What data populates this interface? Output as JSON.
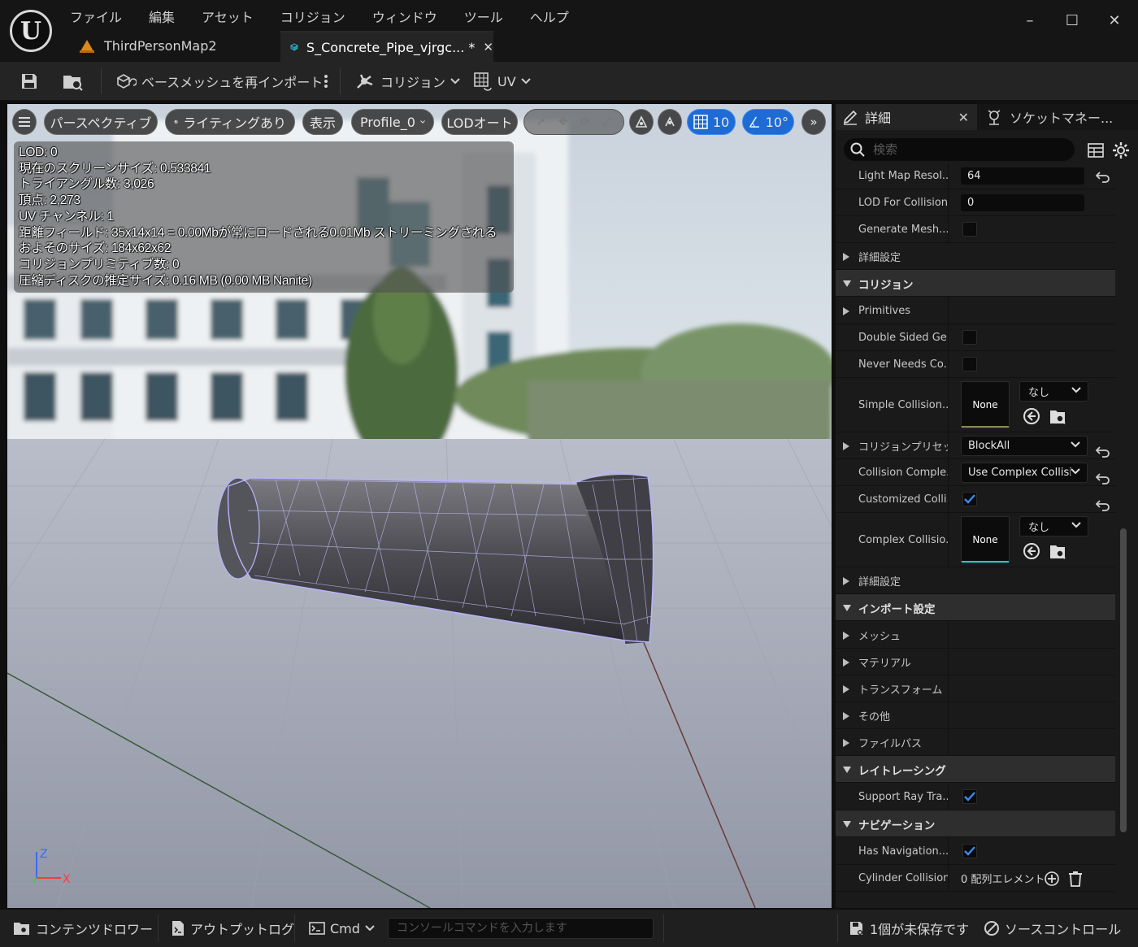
{
  "menu": [
    "ファイル",
    "編集",
    "アセット",
    "コリジョン",
    "ウィンドウ",
    "ツール",
    "ヘルプ"
  ],
  "tabs": {
    "map": "ThirdPersonMap2",
    "mesh": "S_Concrete_Pipe_vjrgc... *"
  },
  "toolbar": {
    "reimport": "ベースメッシュを再インポート",
    "collision": "コリジョン",
    "uv": "UV"
  },
  "viewport": {
    "perspective": "パースペクティブ",
    "lighting": "ライティングあり",
    "show": "表示",
    "profile": "Profile_0",
    "lod": "LODオート",
    "grid_snap": "10",
    "rot_snap": "10°",
    "stats": [
      "LOD: 0",
      "現在のスクリーンサイズ: 0.533841",
      "トライアングル数: 3,026",
      "頂点: 2,273",
      "UV チャンネル: 1",
      "距離フィールド: 35x14x14 = 0.00Mbが常にロードされる0.01Mb ストリーミングされる",
      "およそのサイズ: 184x62x62",
      "コリジョンプリミティブ数: 0",
      "圧縮ディスクの推定サイズ: 0.16 MB (0.00 MB Nanite)"
    ],
    "axis_z": "Z",
    "axis_x": "X"
  },
  "details": {
    "tab_details": "詳細",
    "tab_sockets": "ソケットマネー...",
    "search_placeholder": "検索",
    "rows": {
      "light_map_res": {
        "name": "Light Map Resol...",
        "value": "64"
      },
      "lod_for_collision": {
        "name": "LOD For Collision",
        "value": "0"
      },
      "generate_mesh": {
        "name": "Generate Mesh..."
      },
      "advanced1": {
        "name": "詳細設定"
      },
      "cat_collision": {
        "name": "コリジョン"
      },
      "primitives": {
        "name": "Primitives"
      },
      "double_sided": {
        "name": "Double Sided Ge..."
      },
      "never_needs": {
        "name": "Never Needs Co..."
      },
      "simple_collision": {
        "name": "Simple Collision...",
        "thumb": "None",
        "dd": "なし"
      },
      "collision_preset": {
        "name": "コリジョンプリセット",
        "value": "BlockAll"
      },
      "collision_complexity": {
        "name": "Collision Comple...",
        "value": "Use Complex Collisi"
      },
      "customized_coll": {
        "name": "Customized Colli..."
      },
      "complex_collision": {
        "name": "Complex Collisio...",
        "thumb": "None",
        "dd": "なし"
      },
      "advanced2": {
        "name": "詳細設定"
      },
      "cat_import": {
        "name": "インポート設定"
      },
      "mesh": {
        "name": "メッシュ"
      },
      "material": {
        "name": "マテリアル"
      },
      "transform": {
        "name": "トランスフォーム"
      },
      "misc": {
        "name": "その他"
      },
      "filepath": {
        "name": "ファイルパス"
      },
      "cat_raytracing": {
        "name": "レイトレーシング"
      },
      "support_ray": {
        "name": "Support Ray Tra..."
      },
      "cat_navigation": {
        "name": "ナビゲーション"
      },
      "has_navigation": {
        "name": "Has Navigation..."
      },
      "cylinder_collision": {
        "name": "Cylinder Collision",
        "value": "0 配列エレメント"
      }
    }
  },
  "statusbar": {
    "content_drawer": "コンテンツドロワー",
    "output_log": "アウトプットログ",
    "cmd": "Cmd",
    "console_placeholder": "コンソールコマンドを入力します",
    "unsaved": "1個が未保存です",
    "source_control": "ソースコントロール"
  },
  "colors": {
    "accent_blue": "#1e6bd6",
    "check_blue": "#3a8af0",
    "thumb_bar_yellow": "#8a8a5a",
    "thumb_bar_cyan": "#27c4d8",
    "mesh_tab_icon": "#33b6d0"
  }
}
